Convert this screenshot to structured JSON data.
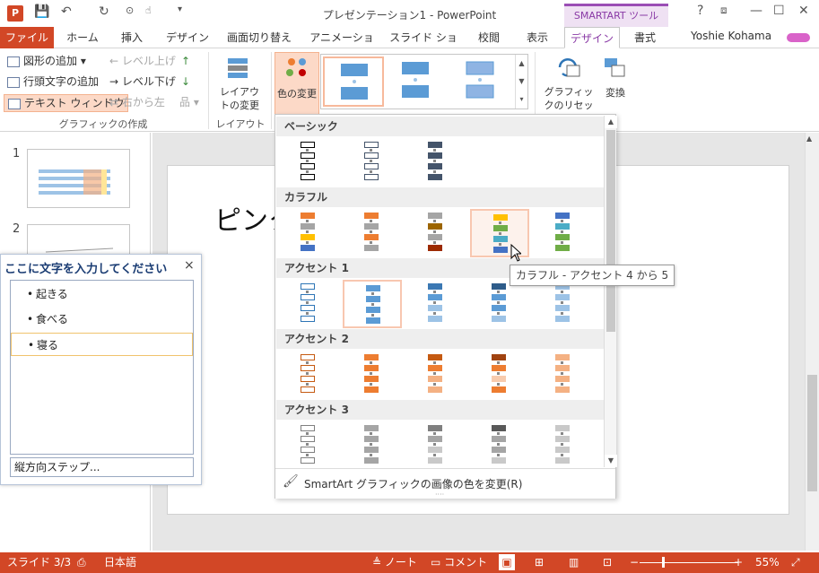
{
  "window": {
    "title": "プレゼンテーション1 - PowerPoint",
    "context_tab": "SMARTART ツール",
    "help": "?",
    "minimize": "—",
    "maximize": "☐",
    "close": "✕"
  },
  "quick_access": {
    "save": "💾",
    "undo": "↶",
    "redo": "↻"
  },
  "tabs": [
    "ファイル",
    "ホーム",
    "挿入",
    "デザイン",
    "画面切り替え",
    "アニメーション",
    "スライド ショー",
    "校閲",
    "表示",
    "デザイン",
    "書式"
  ],
  "user": {
    "name": "Yoshie Kohama"
  },
  "ribbon": {
    "create_group": {
      "add_shape": "図形の追加",
      "add_bullet": "行頭文字の追加",
      "text_window": "テキスト ウィンドウ",
      "level_up": "レベル上げ",
      "level_down": "レベル下げ",
      "right_to_left": "右から左",
      "label": "グラフィックの作成"
    },
    "layout_group": {
      "change_layout": "レイアウトの変更",
      "label": "レイアウト"
    },
    "color_change": "色の変更",
    "reset_graphic": "グラフィックのリセット",
    "convert": "変換"
  },
  "thumbnails": [
    {
      "num": "1"
    },
    {
      "num": "2"
    }
  ],
  "slide": {
    "title": "ピンク"
  },
  "text_pane": {
    "title": "ここに文字を入力してください",
    "close": "×",
    "bullets": [
      "起きる",
      "食べる",
      "寝る"
    ],
    "footer": "縦方向ステップ..."
  },
  "color_dropdown": {
    "categories": [
      "ベーシック",
      "カラフル",
      "アクセント 1",
      "アクセント 2",
      "アクセント 3"
    ],
    "footer": "SmartArt グラフィックの画像の色を変更(R)",
    "tooltip": "カラフル - アクセント 4 から 5",
    "rows": [
      [
        [
          "#ffffff",
          "#ffffff",
          "#ffffff",
          "#ffffff"
        ],
        [
          "#ffffff",
          "#ffffff",
          "#ffffff",
          "#ffffff"
        ],
        [
          "#44546a",
          "#44546a",
          "#44546a",
          "#44546a"
        ]
      ],
      [
        [
          "#ed7d31",
          "#a5a5a5",
          "#ffc000",
          "#4472c4"
        ],
        [
          "#ed7d31",
          "#a5a5a5",
          "#ed7d31",
          "#a5a5a5"
        ],
        [
          "#a5a5a5",
          "#9c6500",
          "#a5a5a5",
          "#9c2a00"
        ],
        [
          "#ffc000",
          "#70ad47",
          "#4bacc6",
          "#4472c4"
        ],
        [
          "#4472c4",
          "#4bacc6",
          "#70ad47",
          "#70ad47"
        ]
      ],
      [
        [
          "#ffffff",
          "#ffffff",
          "#ffffff",
          "#ffffff"
        ],
        [
          "#5b9bd5",
          "#5b9bd5",
          "#5b9bd5",
          "#5b9bd5"
        ],
        [
          "#3b78b3",
          "#5b9bd5",
          "#9dc3e6",
          "#9dc3e6"
        ],
        [
          "#2e5c8a",
          "#5b9bd5",
          "#5b9bd5",
          "#9dc3e6"
        ],
        [
          "#9dc3e6",
          "#9dc3e6",
          "#9dc3e6",
          "#9dc3e6"
        ]
      ],
      [
        [
          "#ffffff",
          "#ffffff",
          "#ffffff",
          "#ffffff"
        ],
        [
          "#ed7d31",
          "#ed7d31",
          "#ed7d31",
          "#ed7d31"
        ],
        [
          "#c55a11",
          "#ed7d31",
          "#f4b183",
          "#f4b183"
        ],
        [
          "#a04310",
          "#ed7d31",
          "#f8cbad",
          "#ed7d31"
        ],
        [
          "#f4b183",
          "#f4b183",
          "#f4b183",
          "#f4b183"
        ]
      ],
      [
        [
          "#ffffff",
          "#ffffff",
          "#ffffff",
          "#ffffff"
        ],
        [
          "#a5a5a5",
          "#a5a5a5",
          "#a5a5a5",
          "#a5a5a5"
        ],
        [
          "#7f7f7f",
          "#a5a5a5",
          "#c9c9c9",
          "#c9c9c9"
        ],
        [
          "#595959",
          "#a5a5a5",
          "#a5a5a5",
          "#c9c9c9"
        ],
        [
          "#c9c9c9",
          "#c9c9c9",
          "#c9c9c9",
          "#c9c9c9"
        ]
      ]
    ],
    "outline_colors": [
      "#000000",
      "#44546a",
      "#44546a",
      "#2e75b6",
      "#c55a11",
      "#7f7f7f"
    ]
  },
  "status": {
    "slide": "スライド 3/3",
    "language": "日本語",
    "notes": "ノート",
    "comments": "コメント",
    "zoom": "55%"
  }
}
